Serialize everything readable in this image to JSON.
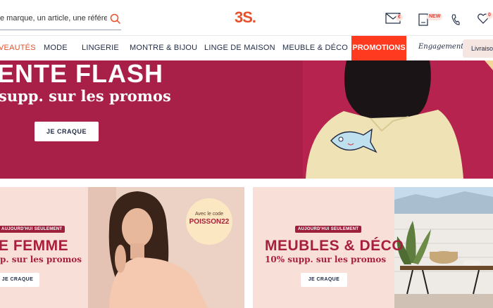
{
  "header": {
    "search_text": "e marque, un article, une référence",
    "logo": "3S.",
    "mail_badge": "€",
    "new_badge": "NEW",
    "cart_badge": "0"
  },
  "nav": {
    "items": [
      "VEAUTÉS",
      "MODE",
      "LINGERIE",
      "MONTRE & BIJOU",
      "LINGE DE MAISON",
      "MEUBLE & DÉCO"
    ],
    "promo": "PROMOTIONS",
    "engagements": "Engagements",
    "delivery": "Livraison"
  },
  "hero": {
    "title": "ENTE FLASH",
    "subtitle": "supp. sur les promos",
    "button": "JE CRAQUE"
  },
  "card_left": {
    "pill": "AUJOURD'HUI SEULEMENT",
    "title": "E FEMME",
    "subtitle": "p. sur les promos",
    "button": "JE CRAQUE",
    "code_label": "Avec le code",
    "code": "POISSON22"
  },
  "card_right": {
    "pill": "AUJOURD'HUI SEULEMENT",
    "title": "MEUBLES & DÉCO",
    "subtitle": "10% supp. sur les promos",
    "button": "JE CRAQUE"
  },
  "colors": {
    "accent": "#e8502b",
    "promo_bg": "#ff3a1f",
    "hero_bg": "#a81f47",
    "card_title": "#a81f3b"
  }
}
